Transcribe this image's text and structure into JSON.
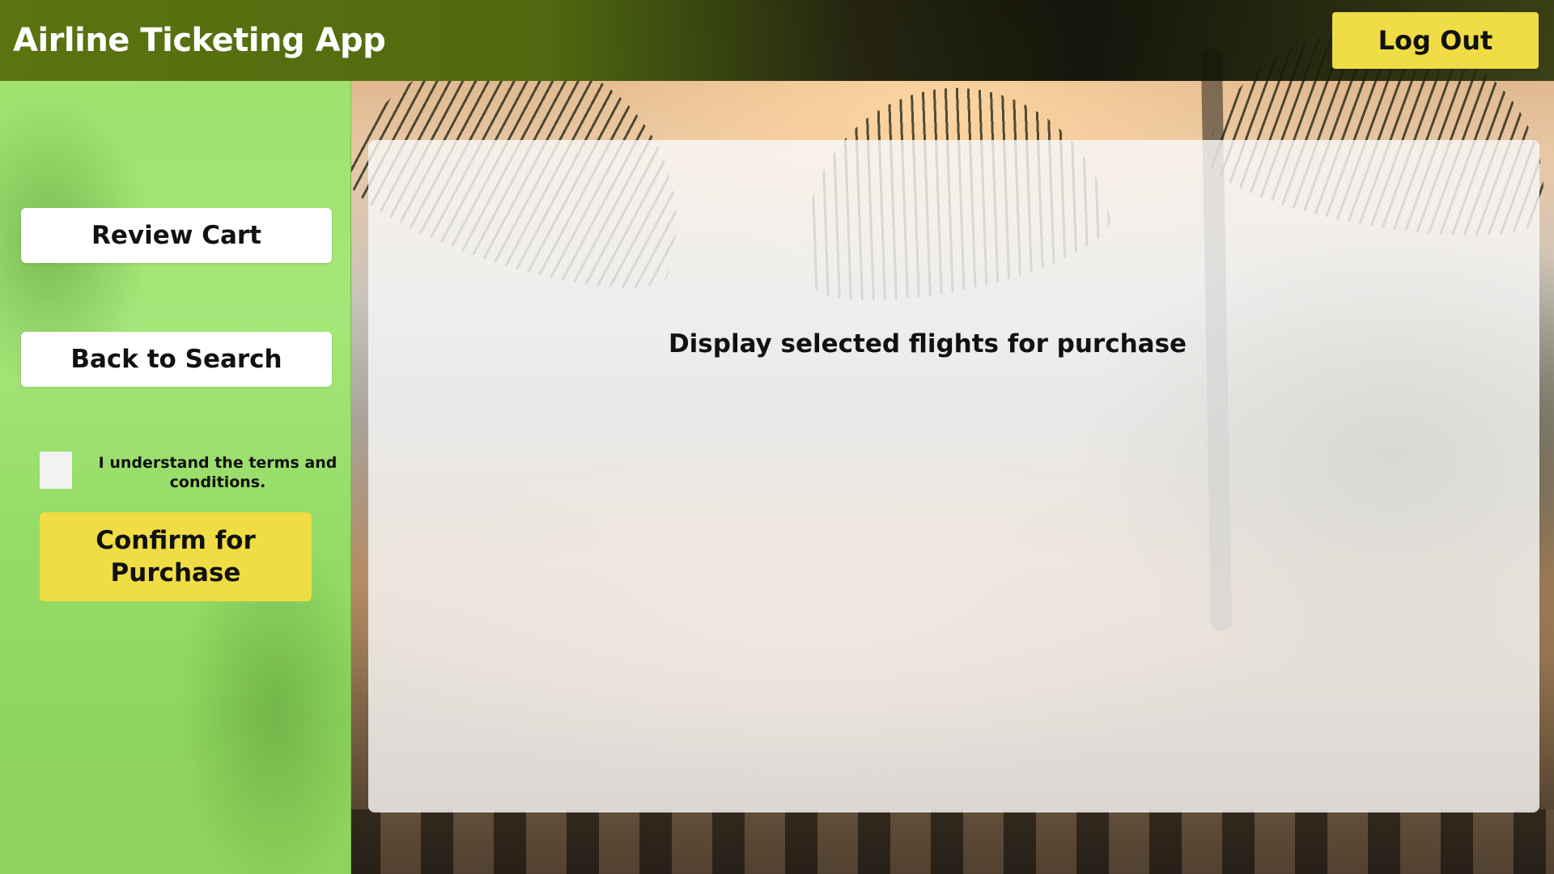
{
  "header": {
    "title": "Airline Ticketing App",
    "logout_label": "Log Out"
  },
  "sidebar": {
    "review_cart_label": "Review Cart",
    "back_to_search_label": "Back to Search",
    "terms_label": "I understand the terms and conditions.",
    "terms_checked": false,
    "confirm_label": "Confirm for Purchase"
  },
  "main": {
    "placeholder_text": "Display selected flights for purchase"
  },
  "colors": {
    "accent_yellow": "#f0dc44",
    "sidebar_green": "#9fe26f",
    "header_green": "#5b7411",
    "panel_white": "#f8f8f8"
  }
}
